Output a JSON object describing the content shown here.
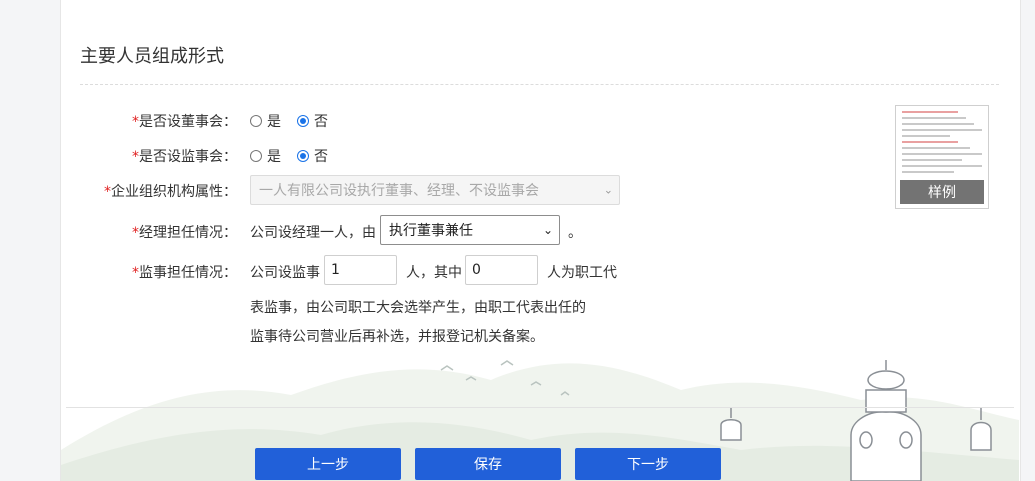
{
  "section": {
    "title": "主要人员组成形式"
  },
  "fields": {
    "board": {
      "label": "是否设董事会：",
      "options": [
        "是",
        "否"
      ],
      "selected": "否"
    },
    "supervisory_board": {
      "label": "是否设监事会：",
      "options": [
        "是",
        "否"
      ],
      "selected": "否"
    },
    "org_attribute": {
      "label": "企业组织机构属性：",
      "value": "一人有限公司设执行董事、经理、不设监事会"
    },
    "manager": {
      "label": "经理担任情况：",
      "prefix": "公司设经理一人，由",
      "value": "执行董事兼任",
      "suffix": "。"
    },
    "supervisor": {
      "label": "监事担任情况：",
      "text1": "公司设监事",
      "count": "1",
      "text2": "人，其中",
      "staff_count": "0",
      "text3": "人为职工代",
      "line2": "表监事，由公司职工大会选举产生，由职工代表出任的",
      "line3": "监事待公司营业后再补选，并报登记机关备案。"
    }
  },
  "required_mark": "*",
  "sample": {
    "label": "样例"
  },
  "buttons": {
    "prev": "上一步",
    "save": "保存",
    "next": "下一步"
  },
  "colors": {
    "primary": "#2160d9",
    "required": "#e02020",
    "radio": "#1a73e8"
  }
}
